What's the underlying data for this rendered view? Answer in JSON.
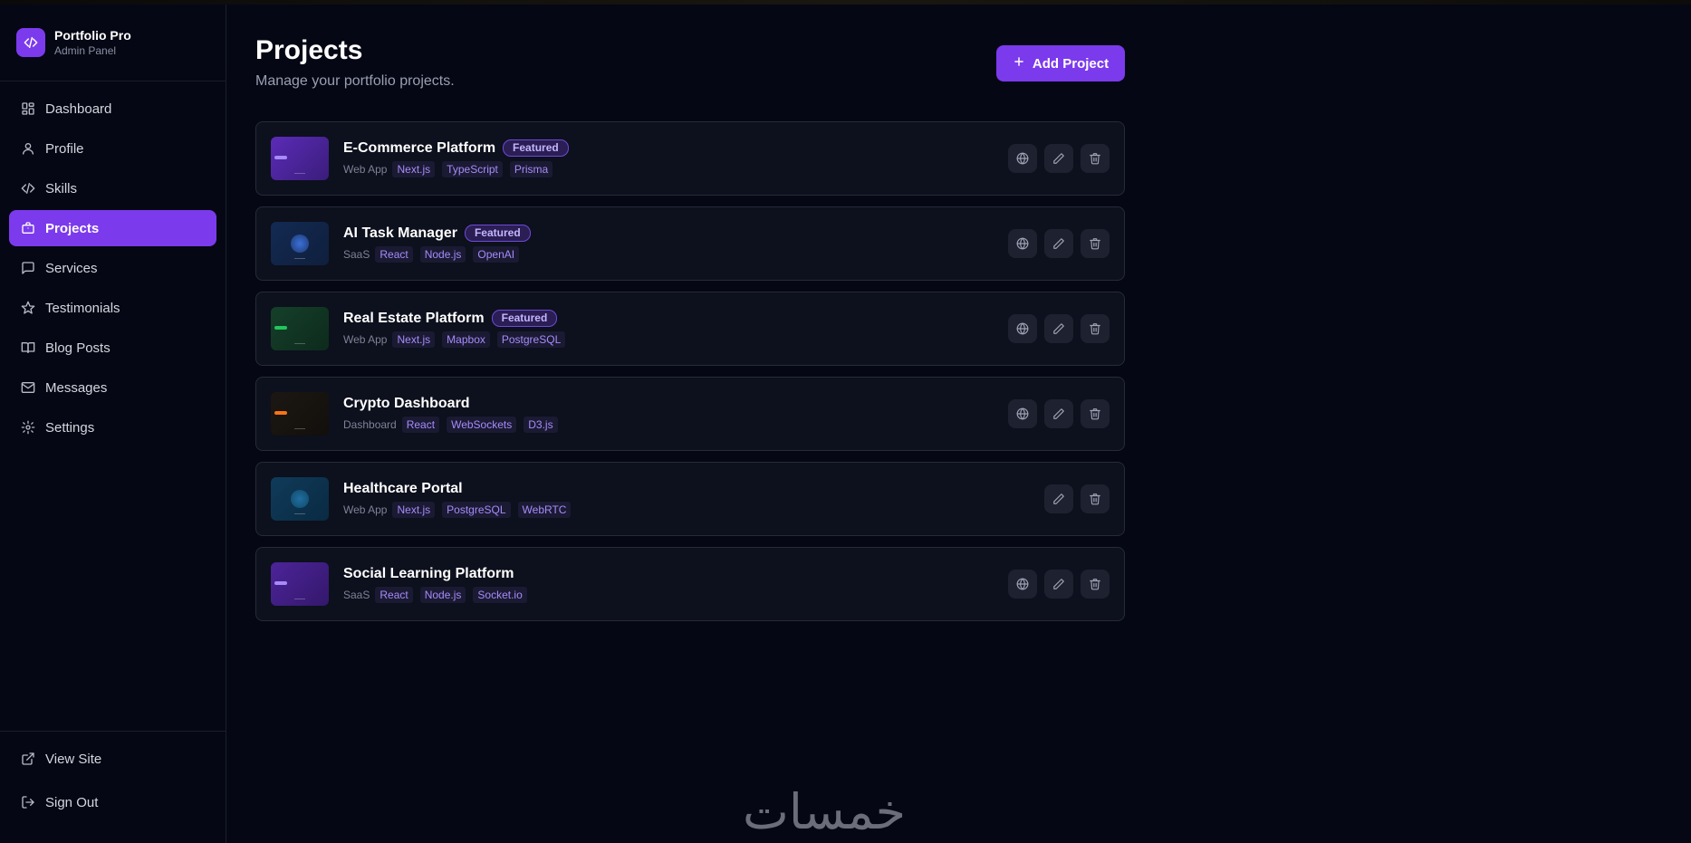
{
  "brand": {
    "title": "Portfolio Pro",
    "subtitle": "Admin Panel"
  },
  "sidebar": {
    "items": [
      {
        "label": "Dashboard",
        "icon": "grid-icon"
      },
      {
        "label": "Profile",
        "icon": "user-icon"
      },
      {
        "label": "Skills",
        "icon": "code-icon"
      },
      {
        "label": "Projects",
        "icon": "briefcase-icon",
        "active": true
      },
      {
        "label": "Services",
        "icon": "chat-icon"
      },
      {
        "label": "Testimonials",
        "icon": "star-icon"
      },
      {
        "label": "Blog Posts",
        "icon": "book-icon"
      },
      {
        "label": "Messages",
        "icon": "mail-icon"
      },
      {
        "label": "Settings",
        "icon": "gear-icon"
      }
    ],
    "bottom": [
      {
        "label": "View Site",
        "icon": "external-link-icon"
      },
      {
        "label": "Sign Out",
        "icon": "logout-icon"
      }
    ]
  },
  "header": {
    "title": "Projects",
    "subtitle": "Manage your portfolio projects.",
    "add_label": "Add Project"
  },
  "projects": [
    {
      "title": "E-Commerce Platform",
      "featured": "Featured",
      "category": "Web App",
      "tags": [
        "Next.js",
        "TypeScript",
        "Prisma"
      ],
      "has_site": true
    },
    {
      "title": "AI Task Manager",
      "featured": "Featured",
      "category": "SaaS",
      "tags": [
        "React",
        "Node.js",
        "OpenAI"
      ],
      "has_site": true
    },
    {
      "title": "Real Estate Platform",
      "featured": "Featured",
      "category": "Web App",
      "tags": [
        "Next.js",
        "Mapbox",
        "PostgreSQL"
      ],
      "has_site": true
    },
    {
      "title": "Crypto Dashboard",
      "featured": "",
      "category": "Dashboard",
      "tags": [
        "React",
        "WebSockets",
        "D3.js"
      ],
      "has_site": true
    },
    {
      "title": "Healthcare Portal",
      "featured": "",
      "category": "Web App",
      "tags": [
        "Next.js",
        "PostgreSQL",
        "WebRTC"
      ],
      "has_site": false
    },
    {
      "title": "Social Learning Platform",
      "featured": "",
      "category": "SaaS",
      "tags": [
        "React",
        "Node.js",
        "Socket.io"
      ],
      "has_site": true
    }
  ],
  "colors": {
    "accent": "#7c3aed",
    "background": "#050714",
    "card": "#0d101d"
  },
  "watermark": "خمسات"
}
